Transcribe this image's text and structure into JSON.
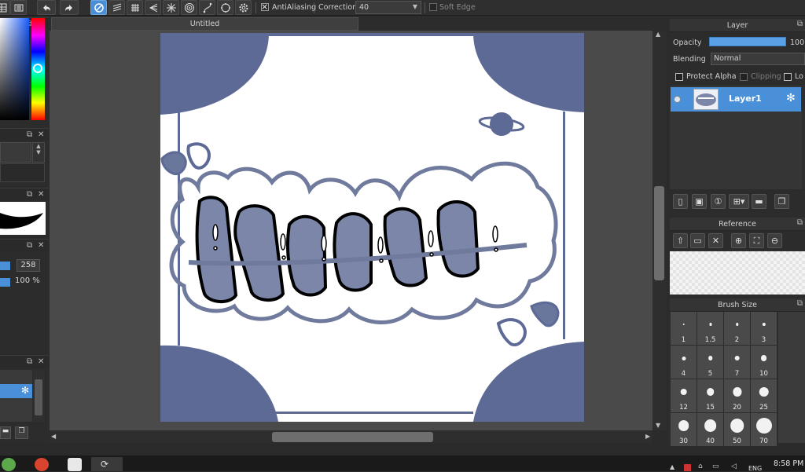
{
  "toolbar": {
    "antialiasing_label": "AntiAliasing",
    "correction_label": "Correction",
    "correction_value": "40",
    "soft_edge_label": "Soft Edge"
  },
  "document": {
    "tab_title": "Untitled"
  },
  "left_panel": {
    "value_a": "258",
    "value_b": "100 %"
  },
  "layer_panel": {
    "title": "Layer",
    "opacity_label": "Opacity",
    "opacity_value": "100",
    "opacity_fraction": 1.0,
    "blending_label": "Blending",
    "blending_value": "Normal",
    "protect_alpha_label": "Protect Alpha",
    "clipping_label": "Clipping",
    "lock_label": "Lo",
    "layers": [
      {
        "name": "Layer1",
        "selected": true
      }
    ]
  },
  "reference_panel": {
    "title": "Reference"
  },
  "brush_panel": {
    "title": "Brush Size",
    "sizes": [
      "1",
      "1.5",
      "2",
      "3",
      "4",
      "5",
      "7",
      "10",
      "12",
      "15",
      "20",
      "25",
      "30",
      "40",
      "50",
      "70"
    ]
  },
  "taskbar": {
    "time": "8:58 PM",
    "lang": "ENG"
  },
  "colors": {
    "accent": "#4a90d8",
    "art_fill": "#5c6a95",
    "art_letters": "#7b86a8",
    "art_outline": "#6f7a9c"
  },
  "icons": [
    "undo-icon",
    "redo-icon",
    "select-none-icon",
    "gear-icon",
    "eye-icon",
    "new-layer-icon",
    "folder-icon",
    "zoom-in-icon",
    "zoom-out-icon",
    "close-icon"
  ]
}
